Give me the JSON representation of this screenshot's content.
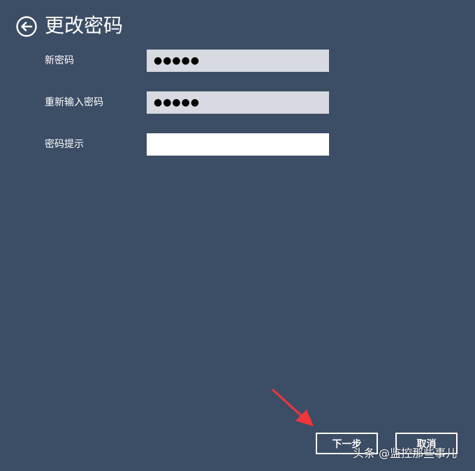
{
  "header": {
    "title": "更改密码",
    "back_icon": "back-arrow-circle-icon"
  },
  "form": {
    "new_password": {
      "label": "新密码",
      "value": "●●●●●"
    },
    "confirm_password": {
      "label": "重新输入密码",
      "value": "●●●●●"
    },
    "password_hint": {
      "label": "密码提示",
      "value": ""
    }
  },
  "buttons": {
    "next_label": "下一步",
    "cancel_label": "取消"
  },
  "annotation": {
    "arrow_color": "#f2353b"
  },
  "watermark": {
    "text": "头条 @监控那些事儿"
  },
  "colors": {
    "background": "#3c4d66",
    "filled_input": "#d7dae0",
    "empty_input": "#ffffff"
  }
}
